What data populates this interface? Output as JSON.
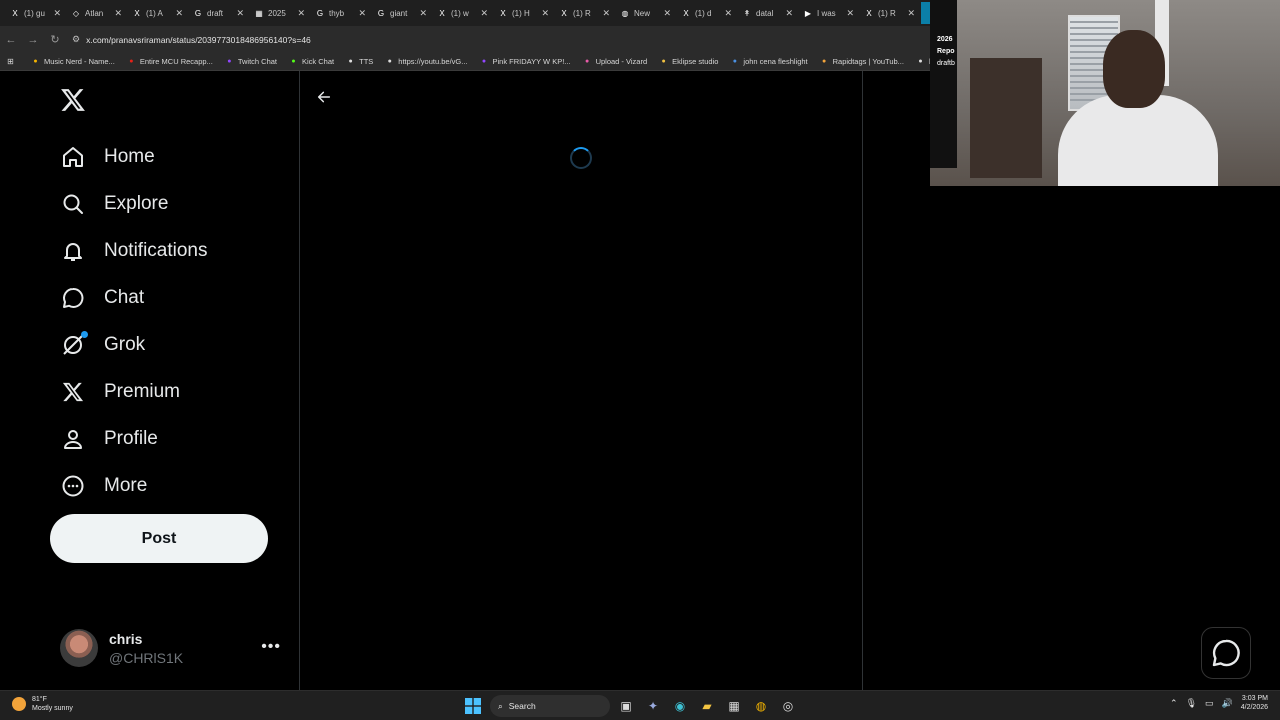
{
  "browser": {
    "tabs": [
      {
        "icon": "x-icon",
        "glyph": "X",
        "label": "(1) gu"
      },
      {
        "icon": "atlas-icon",
        "glyph": "◇",
        "label": "Atlan"
      },
      {
        "icon": "x-icon",
        "glyph": "X",
        "label": "(1) A"
      },
      {
        "icon": "google-icon",
        "glyph": "G",
        "label": "draft"
      },
      {
        "icon": "sheet-icon",
        "glyph": "▦",
        "label": "2025"
      },
      {
        "icon": "google-icon",
        "glyph": "G",
        "label": "thyb"
      },
      {
        "icon": "google-icon",
        "glyph": "G",
        "label": "giant"
      },
      {
        "icon": "x-icon",
        "glyph": "X",
        "label": "(1) w"
      },
      {
        "icon": "x-icon",
        "glyph": "X",
        "label": "(1) H"
      },
      {
        "icon": "x-icon",
        "glyph": "X",
        "label": "(1) R"
      },
      {
        "icon": "chrome-icon",
        "glyph": "◍",
        "label": "New"
      },
      {
        "icon": "x-icon",
        "glyph": "X",
        "label": "(1) d"
      },
      {
        "icon": "sportsdata-icon",
        "glyph": "↟",
        "label": "datal"
      },
      {
        "icon": "youtube-icon",
        "glyph": "▶",
        "label": "I was"
      },
      {
        "icon": "x-icon",
        "glyph": "X",
        "label": "(1) R"
      }
    ],
    "url": "x.com/pranavsriraman/status/2039773018486956140?s=46",
    "bookmarks": [
      {
        "icon": "music-icon",
        "label": "Music Nerd - Name..."
      },
      {
        "icon": "youtube-icon",
        "label": "Entire MCU Recapp..."
      },
      {
        "icon": "twitch-icon",
        "label": "Twitch Chat"
      },
      {
        "icon": "kick-icon",
        "label": "Kick Chat"
      },
      {
        "icon": "tts-icon",
        "label": "TTS"
      },
      {
        "icon": "globe-icon",
        "label": "https://youtu.be/vG..."
      },
      {
        "icon": "twitch-icon",
        "label": "Pink FRIDAYY W KP!..."
      },
      {
        "icon": "vizard-icon",
        "label": "Upload - Vizard"
      },
      {
        "icon": "eklipse-icon",
        "label": "Eklipse studio"
      },
      {
        "icon": "search-icon",
        "label": "john cena fleshlight"
      },
      {
        "icon": "rapidtags-icon",
        "label": "Rapidtags | YouTub..."
      },
      {
        "icon": "globe-icon",
        "label": "bih"
      }
    ]
  },
  "x": {
    "logo": "X",
    "nav": [
      {
        "name": "home",
        "label": "Home"
      },
      {
        "name": "explore",
        "label": "Explore"
      },
      {
        "name": "notifications",
        "label": "Notifications"
      },
      {
        "name": "chat",
        "label": "Chat"
      },
      {
        "name": "grok",
        "label": "Grok"
      },
      {
        "name": "premium",
        "label": "Premium"
      },
      {
        "name": "profile",
        "label": "Profile"
      },
      {
        "name": "more",
        "label": "More"
      }
    ],
    "post_label": "Post",
    "account": {
      "name": "chris",
      "handle": "@CHRlS1K"
    }
  },
  "webcam": {
    "overlay_line1": "2026",
    "overlay_line2": "Repo",
    "overlay_line3": "draftb"
  },
  "taskbar": {
    "weather_temp": "81°F",
    "weather_desc": "Mostly sunny",
    "search_label": "Search",
    "time": "3:03 PM",
    "date": "4/2/2026"
  }
}
